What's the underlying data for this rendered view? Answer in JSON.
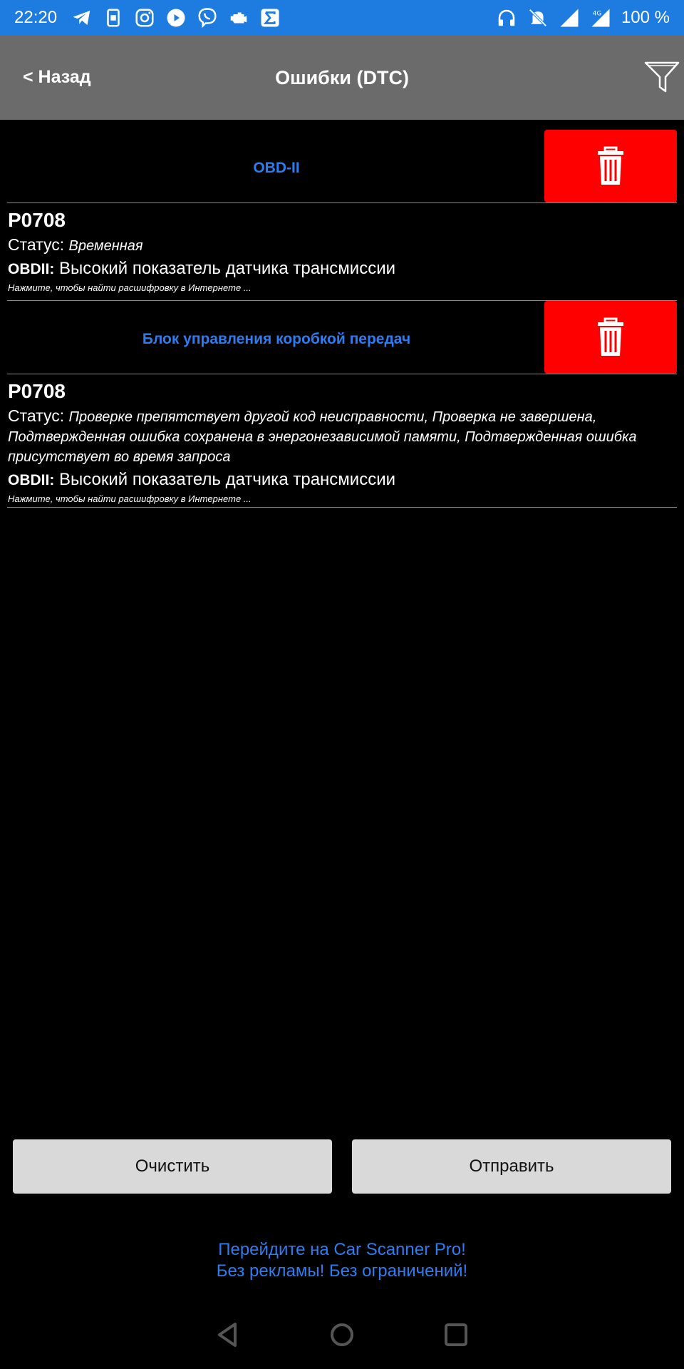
{
  "status_bar": {
    "time": "22:20",
    "battery": "100 %",
    "network": "4G",
    "icons_left": [
      "telegram-icon",
      "sim-icon",
      "instagram-icon",
      "play-icon",
      "viber-icon",
      "engine-icon",
      "sigma-icon"
    ],
    "icons_right": [
      "headphones-icon",
      "bell-off-icon",
      "signal-icon",
      "signal-4g-icon"
    ]
  },
  "header": {
    "back_label": "< Назад",
    "title": "Ошибки (DTC)",
    "filter_icon": "filter-icon"
  },
  "sections": [
    {
      "title": "OBD-II",
      "delete_icon": "trash-icon",
      "dtcs": [
        {
          "code": "P0708",
          "status_label": "Статус:",
          "status_value": "Временная",
          "desc_prefix": "OBDII:",
          "desc_text": "Высокий показатель датчика трансмиссии",
          "hint": "Нажмите, чтобы найти расшифровку в Интернете ..."
        }
      ]
    },
    {
      "title": "Блок управления коробкой передач",
      "delete_icon": "trash-icon",
      "dtcs": [
        {
          "code": "P0708",
          "status_label": "Статус:",
          "status_value": "Проверке препятствует другой код неисправности, Проверка не завершена, Подтвержденная ошибка сохранена в энергонезависимой памяти, Подтвержденная ошибка присутствует во время запроса",
          "desc_prefix": "OBDII:",
          "desc_text": "Высокий показатель датчика трансмиссии",
          "hint": "Нажмите, чтобы найти расшифровку в Интернете ..."
        }
      ]
    }
  ],
  "buttons": {
    "clear": "Очистить",
    "send": "Отправить"
  },
  "promo": {
    "line1": "Перейдите на Car Scanner Pro!",
    "line2": "Без рекламы! Без ограничений!"
  },
  "colors": {
    "status_bar": "#1e7be0",
    "header": "#6b6b6b",
    "accent_blue": "#2f7cf0",
    "delete_red": "#ff0000",
    "button_gray": "#d9d9d9"
  }
}
